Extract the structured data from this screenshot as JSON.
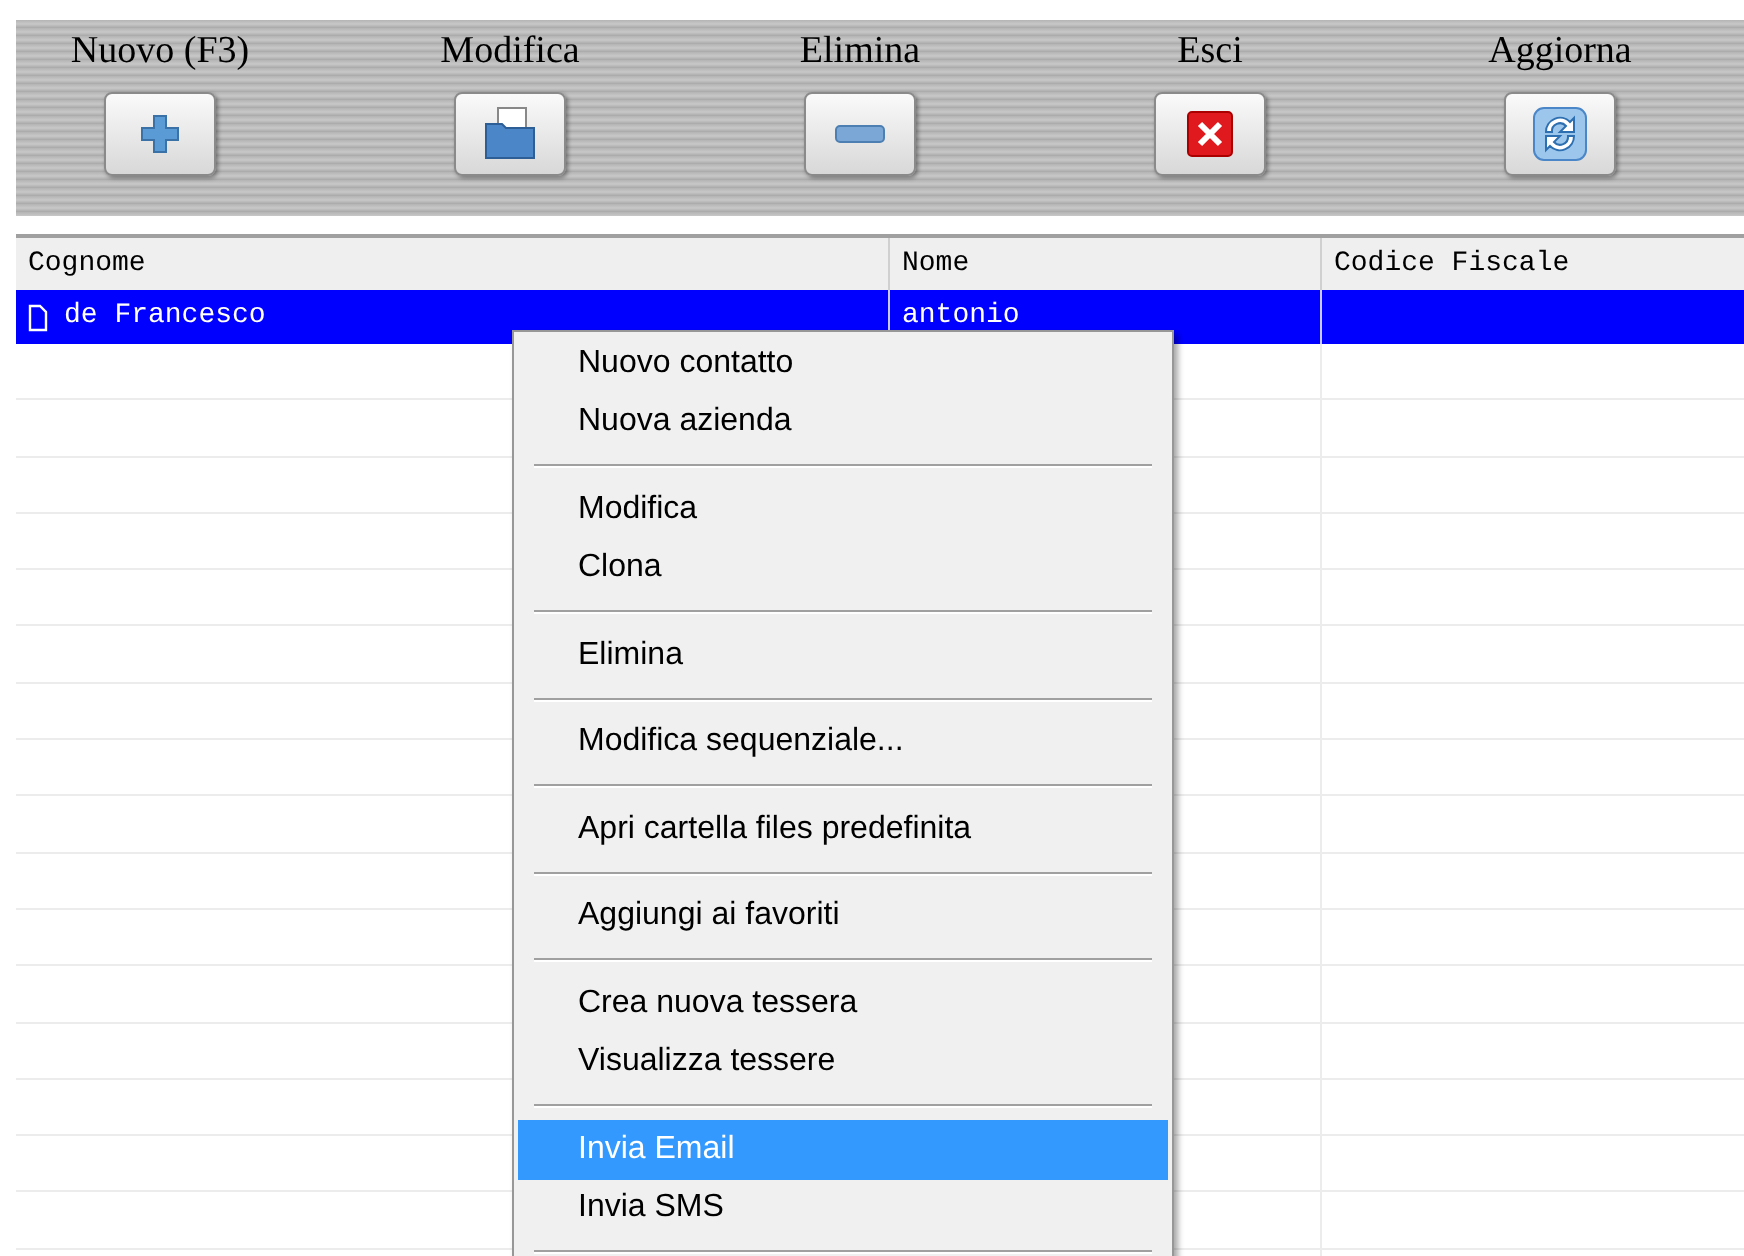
{
  "toolbar": [
    {
      "label": "Nuovo (F3)",
      "kind": "plus"
    },
    {
      "label": "Modifica",
      "kind": "folder"
    },
    {
      "label": "Elimina",
      "kind": "minus"
    },
    {
      "label": "Esci",
      "kind": "close"
    },
    {
      "label": "Aggiorna",
      "kind": "refresh"
    }
  ],
  "table": {
    "columns": [
      "Cognome",
      "Nome",
      "Codice Fiscale"
    ],
    "rows": [
      {
        "cells": [
          "de Francesco",
          "antonio",
          ""
        ],
        "selected": true
      }
    ]
  },
  "context_menu": {
    "groups": [
      {
        "items": [
          {
            "label": "Nuovo contatto",
            "selected": false
          },
          {
            "label": "Nuova azienda",
            "selected": false
          }
        ]
      },
      {
        "items": [
          {
            "label": "Modifica",
            "selected": false
          },
          {
            "label": "Clona",
            "selected": false
          }
        ]
      },
      {
        "items": [
          {
            "label": "Elimina",
            "selected": false
          }
        ]
      },
      {
        "items": [
          {
            "label": "Modifica sequenziale...",
            "selected": false
          }
        ]
      },
      {
        "items": [
          {
            "label": "Apri cartella files predefinita",
            "selected": false
          }
        ]
      },
      {
        "items": [
          {
            "label": "Aggiungi ai favoriti",
            "selected": false
          }
        ]
      },
      {
        "items": [
          {
            "label": "Crea nuova tessera",
            "selected": false
          },
          {
            "label": "Visualizza tessere",
            "selected": false
          }
        ]
      },
      {
        "items": [
          {
            "label": "Invia Email",
            "selected": true
          },
          {
            "label": "Invia SMS",
            "selected": false
          }
        ]
      }
    ]
  }
}
